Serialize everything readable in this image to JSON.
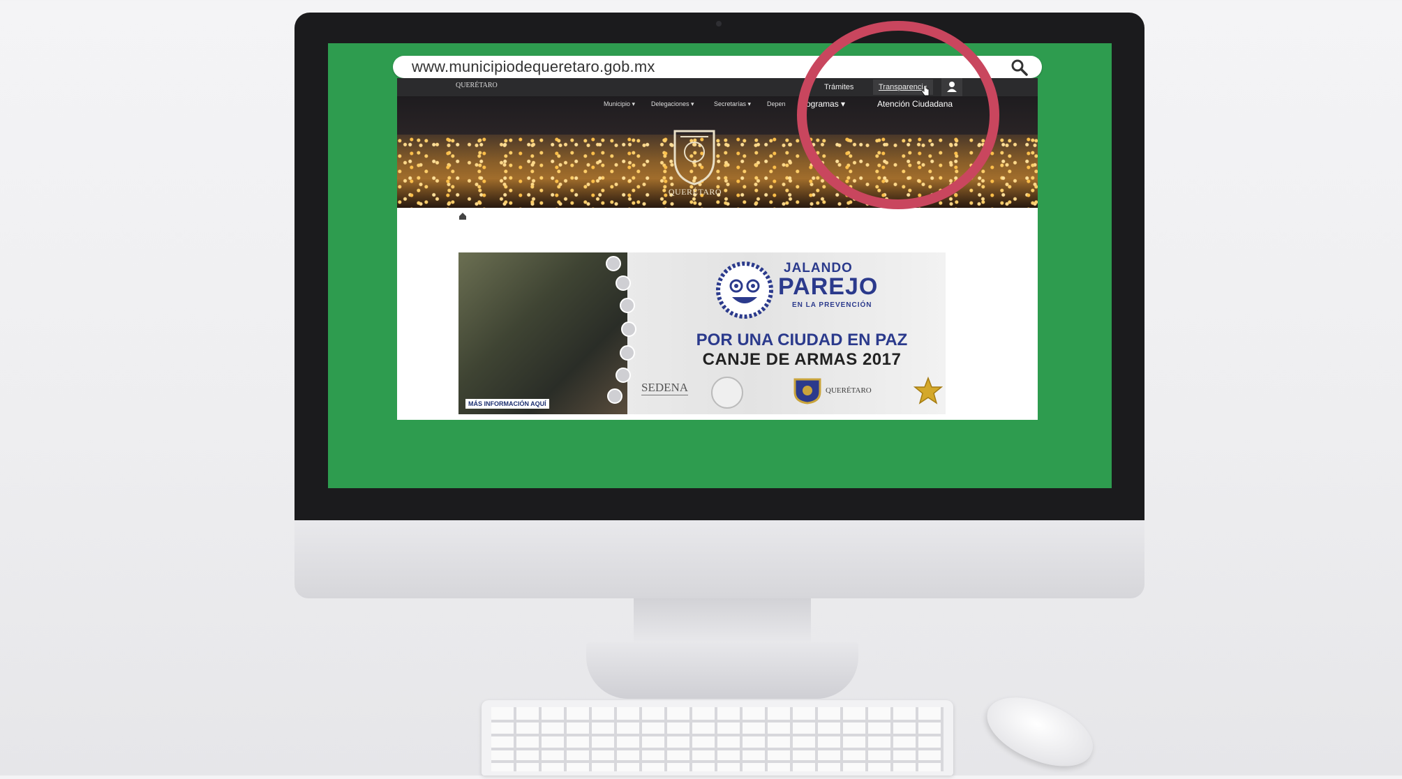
{
  "browser": {
    "url": "www.municipiodequeretaro.gob.mx",
    "search_icon": "search-icon"
  },
  "site": {
    "logo_text": "QUERÉTARO",
    "top_links": [
      "Trámites",
      "Transparencia"
    ],
    "user_icon": "user-icon",
    "nav_items": [
      "Municipio ▾",
      "Delegaciones ▾",
      "Secretarías ▾",
      "Depen",
      "Programas ▾",
      "Atención Ciudadana"
    ],
    "crest_label": "QUERÉTARO",
    "home_icon": "home-icon"
  },
  "banner": {
    "more_info": "MÁS INFORMACIÓN AQUÍ",
    "jalando": "JALANDO",
    "parejo": "PAREJO",
    "prevencion": "EN LA PREVENCIÓN",
    "headline_1": "POR UNA CIUDAD EN PAZ",
    "headline_2": "CANJE DE ARMAS 2017",
    "sedena": "SEDENA",
    "queretaro": "QUERÉTARO"
  },
  "colors": {
    "screen_green": "#2e9c4f",
    "highlight_ring": "#c9465e",
    "banner_blue": "#2b3a8c"
  }
}
